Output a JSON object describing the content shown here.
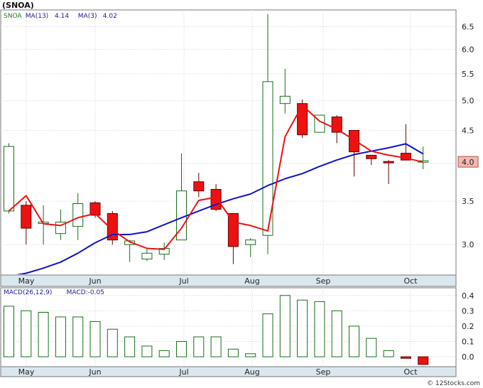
{
  "header": {
    "title": "(SNOA)",
    "watermark": "© 12Stocks.com"
  },
  "price_legend": [
    {
      "text": "SNOA",
      "color": "#1a7a1a"
    },
    {
      "text": "MA(13)",
      "color": "#1a1aa0"
    },
    {
      "text": "4.14",
      "color": "#1a1aa0"
    },
    {
      "text": "MA(3)",
      "color": "#1a1aa0"
    },
    {
      "text": "4.02",
      "color": "#1a1aa0"
    }
  ],
  "macd_legend": [
    {
      "text": "MACD(26,12,9)",
      "color": "#1a1aa0"
    },
    {
      "text": "MACD:-0.05",
      "color": "#1a1aa0"
    }
  ],
  "colors": {
    "up": "#ffffff",
    "up_edge": "#1a6e1a",
    "down": "#ee1111",
    "down_edge": "#660000",
    "ma13": "#1111cc",
    "ma3": "#ee1111",
    "grid": "#d0d0d0",
    "price_marker": "#f4b8b0"
  },
  "chart_data": [
    {
      "type": "candlestick",
      "name": "price",
      "x_labels": [
        "May",
        "Jun",
        "Jul",
        "Aug",
        "Sep",
        "Oct"
      ],
      "y_ticks": [
        "3.0",
        "3.5",
        "4.0",
        "4.5",
        "5.0",
        "5.5",
        "6.0",
        "6.5"
      ],
      "ylim": [
        2.7,
        6.9
      ],
      "y_scale": "log",
      "last_price_label": "4.0",
      "last_price": 4.02,
      "candles": [
        {
          "o": 3.38,
          "c": 4.25,
          "h": 4.3,
          "l": 3.35
        },
        {
          "o": 3.45,
          "c": 3.18,
          "h": 3.5,
          "l": 3.0
        },
        {
          "o": 3.25,
          "c": 3.25,
          "h": 3.45,
          "l": 3.0
        },
        {
          "o": 3.12,
          "c": 3.25,
          "h": 3.4,
          "l": 3.05
        },
        {
          "o": 3.2,
          "c": 3.47,
          "h": 3.6,
          "l": 3.05
        },
        {
          "o": 3.48,
          "c": 3.33,
          "h": 3.5,
          "l": 3.3
        },
        {
          "o": 3.35,
          "c": 3.05,
          "h": 3.38,
          "l": 3.0
        },
        {
          "o": 3.0,
          "c": 3.04,
          "h": 3.05,
          "l": 2.82
        },
        {
          "o": 2.85,
          "c": 2.91,
          "h": 2.96,
          "l": 2.83
        },
        {
          "o": 2.9,
          "c": 2.96,
          "h": 3.02,
          "l": 2.84
        },
        {
          "o": 3.05,
          "c": 3.63,
          "h": 4.15,
          "l": 3.05
        },
        {
          "o": 3.75,
          "c": 3.63,
          "h": 3.87,
          "l": 3.55
        },
        {
          "o": 3.65,
          "c": 3.4,
          "h": 3.72,
          "l": 3.38
        },
        {
          "o": 3.35,
          "c": 2.98,
          "h": 3.35,
          "l": 2.8
        },
        {
          "o": 3.0,
          "c": 3.05,
          "h": 3.07,
          "l": 2.87
        },
        {
          "o": 3.1,
          "c": 5.35,
          "h": 6.8,
          "l": 2.9
        },
        {
          "o": 4.95,
          "c": 5.08,
          "h": 5.6,
          "l": 4.78
        },
        {
          "o": 4.95,
          "c": 4.43,
          "h": 5.02,
          "l": 4.38
        },
        {
          "o": 4.47,
          "c": 4.75,
          "h": 4.75,
          "l": 4.47
        },
        {
          "o": 4.72,
          "c": 4.47,
          "h": 4.75,
          "l": 4.3
        },
        {
          "o": 4.5,
          "c": 4.17,
          "h": 4.5,
          "l": 3.82
        },
        {
          "o": 4.12,
          "c": 4.07,
          "h": 4.12,
          "l": 3.98
        },
        {
          "o": 4.03,
          "c": 4.02,
          "h": 4.05,
          "l": 3.72
        },
        {
          "o": 4.15,
          "c": 4.05,
          "h": 4.6,
          "l": 4.05
        },
        {
          "o": 4.02,
          "c": 4.04,
          "h": 4.25,
          "l": 3.92
        }
      ],
      "series": [
        {
          "name": "MA(13)",
          "values": [
            2.68,
            2.71,
            2.76,
            2.82,
            2.91,
            3.02,
            3.11,
            3.11,
            3.14,
            3.22,
            3.3,
            3.38,
            3.46,
            3.53,
            3.59,
            3.7,
            3.79,
            3.86,
            3.96,
            4.05,
            4.13,
            4.18,
            4.23,
            4.29,
            4.14
          ]
        },
        {
          "name": "MA(3)",
          "values": [
            3.38,
            3.57,
            3.23,
            3.21,
            3.3,
            3.35,
            3.16,
            3.03,
            2.96,
            2.95,
            3.18,
            3.51,
            3.55,
            3.25,
            3.21,
            3.15,
            4.4,
            4.92,
            4.65,
            4.52,
            4.35,
            4.18,
            4.12,
            4.08,
            4.02
          ]
        }
      ]
    },
    {
      "type": "bar",
      "name": "MACD",
      "x_labels": [
        "May",
        "Jun",
        "Jul",
        "Aug",
        "Sep",
        "Oct"
      ],
      "y_ticks": [
        "0.0",
        "0.1",
        "0.2",
        "0.3",
        "0.4"
      ],
      "ylim": [
        -0.06,
        0.45
      ],
      "values": [
        0.33,
        0.3,
        0.29,
        0.26,
        0.26,
        0.23,
        0.18,
        0.13,
        0.07,
        0.04,
        0.1,
        0.13,
        0.13,
        0.05,
        0.02,
        0.28,
        0.4,
        0.37,
        0.36,
        0.3,
        0.2,
        0.12,
        0.04,
        -0.01,
        -0.05
      ]
    }
  ]
}
